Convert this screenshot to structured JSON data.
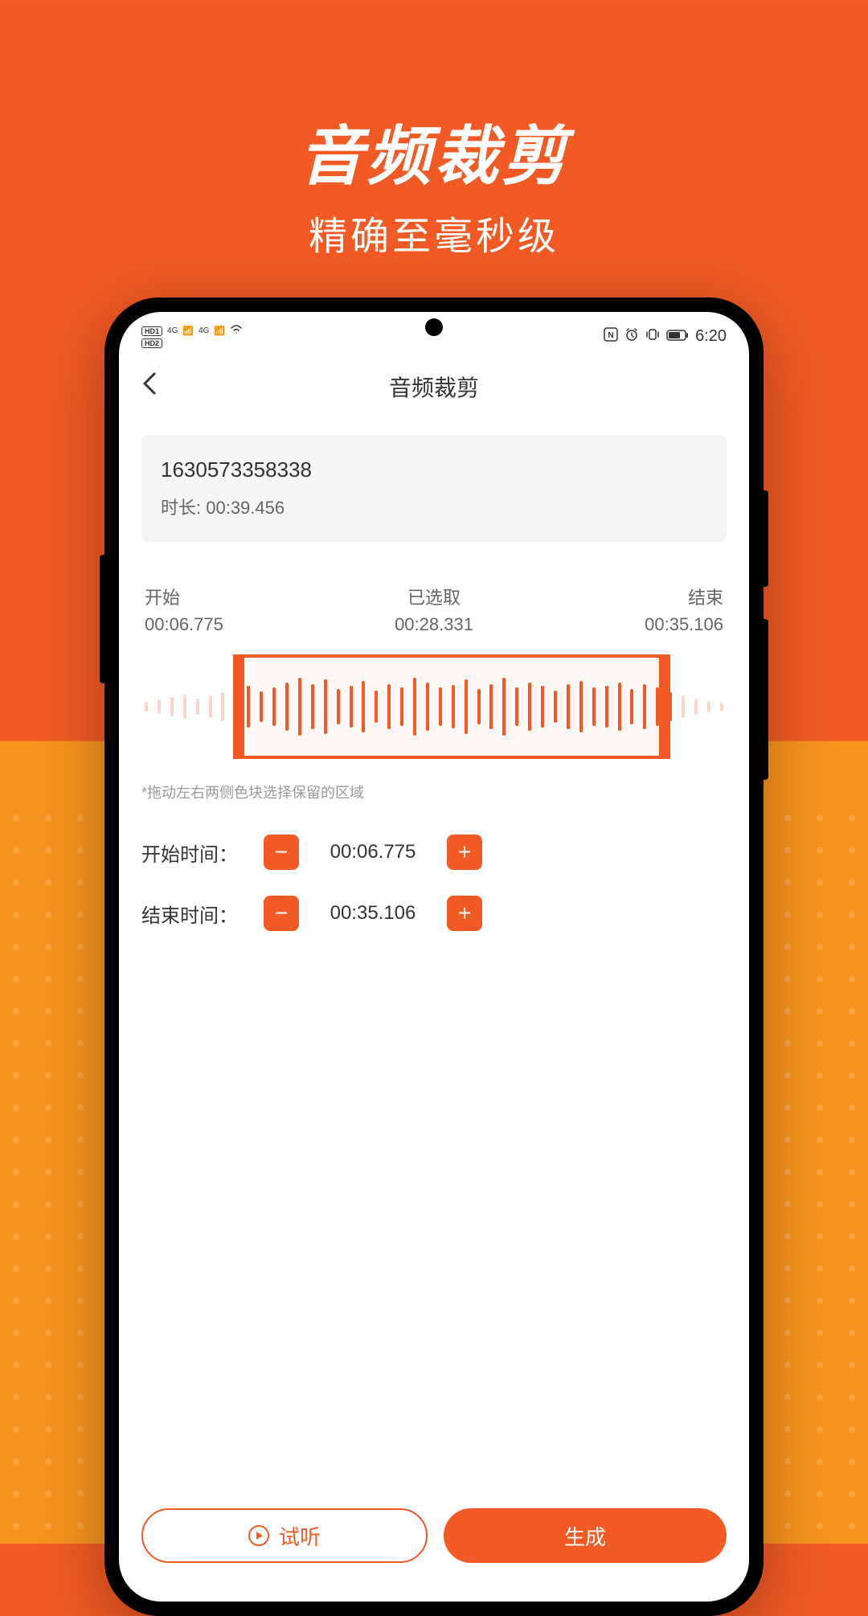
{
  "promo": {
    "title": "音频裁剪",
    "subtitle": "精确至毫秒级"
  },
  "statusBar": {
    "hd1": "HD1",
    "hd2": "HD2",
    "signal1": "4G",
    "signal2": "4G",
    "time": "6:20"
  },
  "header": {
    "title": "音频裁剪"
  },
  "fileInfo": {
    "name": "1630573358338",
    "durationLabel": "时长: ",
    "duration": "00:39.456"
  },
  "timeLabels": {
    "start": {
      "title": "开始",
      "value": "00:06.775"
    },
    "selected": {
      "title": "已选取",
      "value": "00:28.331"
    },
    "end": {
      "title": "结束",
      "value": "00:35.106"
    }
  },
  "waveform": {
    "bars": [
      12,
      18,
      24,
      30,
      20,
      28,
      36,
      44,
      52,
      38,
      48,
      60,
      72,
      56,
      68,
      44,
      52,
      64,
      40,
      56,
      48,
      72,
      60,
      48,
      54,
      68,
      44,
      56,
      72,
      48,
      60,
      52,
      40,
      56,
      64,
      48,
      52,
      60,
      44,
      56,
      48,
      36,
      28,
      20,
      14,
      10
    ],
    "selectionStart": 0.17,
    "selectionEnd": 0.89,
    "fadeStart": 7,
    "fadeEnd": 41
  },
  "hint": "*拖动左右两侧色块选择保留的区域",
  "controls": {
    "startLabel": "开始时间：",
    "startValue": "00:06.775",
    "endLabel": "结束时间：",
    "endValue": "00:35.106",
    "minusLabel": "−",
    "plusLabel": "+"
  },
  "actions": {
    "preview": "试听",
    "generate": "生成"
  }
}
